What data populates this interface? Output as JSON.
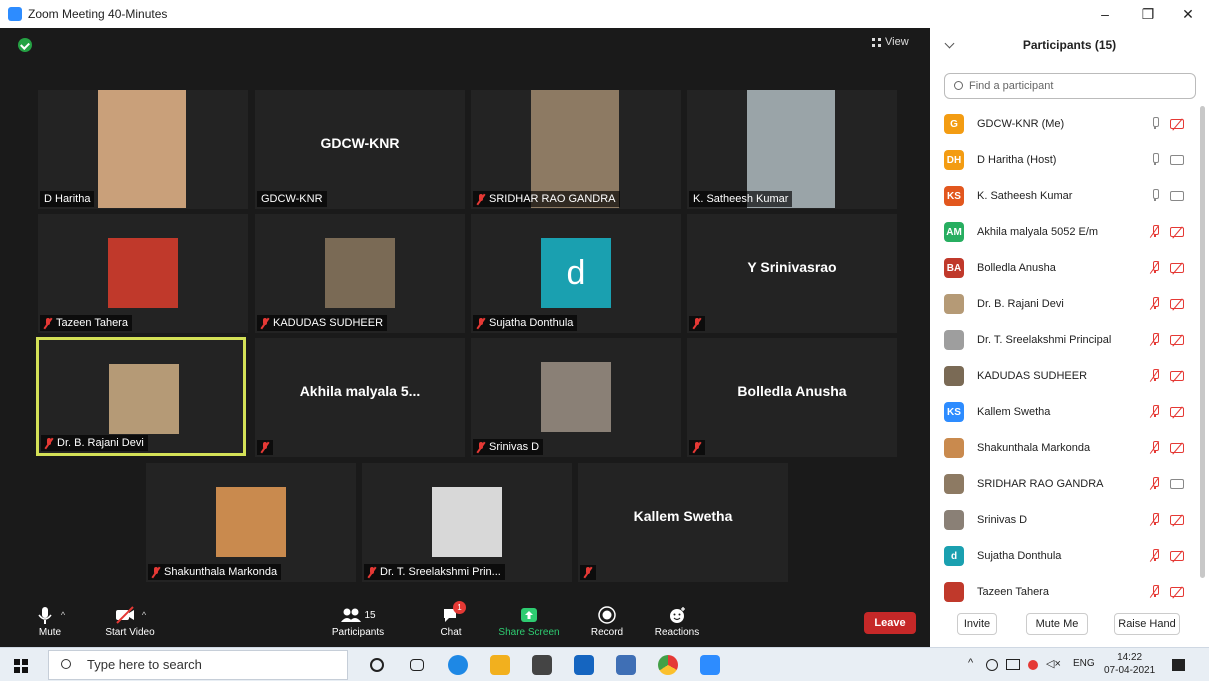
{
  "window": {
    "title": "Zoom Meeting 40-Minutes",
    "minimize": "–",
    "maximize": "❐",
    "close": "✕"
  },
  "view_button": "View",
  "tiles": [
    {
      "name": "D Haritha",
      "muted": false,
      "kind": "photo",
      "color": "#c9a07a"
    },
    {
      "name": "GDCW-KNR",
      "muted": false,
      "kind": "name",
      "center": "GDCW-KNR",
      "label": ""
    },
    {
      "name": "SRIDHAR RAO GANDRA",
      "muted": true,
      "kind": "photo",
      "color": "#8d7a63"
    },
    {
      "name": "K. Satheesh Kumar",
      "muted": false,
      "kind": "photo",
      "color": "#9aa4a8"
    },
    {
      "name": "Tazeen Tahera",
      "muted": true,
      "kind": "photo",
      "color": "#c0392b"
    },
    {
      "name": "KADUDAS SUDHEER",
      "muted": true,
      "kind": "photo",
      "color": "#7a6a55"
    },
    {
      "name": "Sujatha Donthula",
      "muted": true,
      "kind": "letter",
      "letter": "d",
      "color": "#1aa0b0"
    },
    {
      "name": "",
      "muted": true,
      "kind": "name",
      "center": "Y Srinivasrao"
    },
    {
      "name": "Dr. B. Rajani Devi",
      "muted": true,
      "kind": "photo",
      "color": "#b59a76",
      "active": true
    },
    {
      "name": "",
      "muted": true,
      "kind": "name",
      "center": "Akhila malyala 5..."
    },
    {
      "name": "Srinivas D",
      "muted": true,
      "kind": "photo",
      "color": "#8a8076"
    },
    {
      "name": "",
      "muted": true,
      "kind": "name",
      "center": "Bolledla Anusha"
    },
    {
      "name": "Shakunthala Markonda",
      "muted": true,
      "kind": "photo",
      "color": "#c98a4e"
    },
    {
      "name": "Dr. T. Sreelakshmi Prin...",
      "muted": true,
      "kind": "photo",
      "color": "#d8d8d8"
    },
    {
      "name": "",
      "muted": true,
      "kind": "name",
      "center": "Kallem Swetha"
    }
  ],
  "toolbar": {
    "mute": "Mute",
    "start_video": "Start Video",
    "participants": "Participants",
    "participants_count": "15",
    "chat": "Chat",
    "chat_badge": "1",
    "share_screen": "Share Screen",
    "record": "Record",
    "reactions": "Reactions",
    "leave": "Leave"
  },
  "panel": {
    "title": "Participants (15)",
    "search_placeholder": "Find a participant",
    "participants": [
      {
        "initials": "G",
        "name": "GDCW-KNR (Me)",
        "color": "#f39c12",
        "mic": "on",
        "video": "off"
      },
      {
        "initials": "DH",
        "name": "D Haritha (Host)",
        "color": "#f39c12",
        "mic": "on",
        "video": "on"
      },
      {
        "initials": "KS",
        "name": "K. Satheesh Kumar",
        "color": "#e2571e",
        "mic": "on",
        "video": "on"
      },
      {
        "initials": "AM",
        "name": "Akhila malyala 5052 E/m",
        "color": "#27ae60",
        "mic": "off",
        "video": "off"
      },
      {
        "initials": "BA",
        "name": "Bolledla Anusha",
        "color": "#c0392b",
        "mic": "off",
        "video": "off"
      },
      {
        "initials": "",
        "name": "Dr. B. Rajani Devi",
        "color": "#b59a76",
        "mic": "off",
        "video": "off"
      },
      {
        "initials": "",
        "name": "Dr. T. Sreelakshmi Principal",
        "color": "#9e9e9e",
        "mic": "off",
        "video": "off"
      },
      {
        "initials": "",
        "name": "KADUDAS SUDHEER",
        "color": "#7a6a55",
        "mic": "off",
        "video": "off"
      },
      {
        "initials": "KS",
        "name": "Kallem Swetha",
        "color": "#2d8cff",
        "mic": "off",
        "video": "off"
      },
      {
        "initials": "",
        "name": "Shakunthala Markonda",
        "color": "#c98a4e",
        "mic": "off",
        "video": "off"
      },
      {
        "initials": "",
        "name": "SRIDHAR RAO GANDRA",
        "color": "#8d7a63",
        "mic": "off",
        "video": "on"
      },
      {
        "initials": "",
        "name": "Srinivas D",
        "color": "#8a8076",
        "mic": "off",
        "video": "off"
      },
      {
        "initials": "d",
        "name": "Sujatha Donthula",
        "color": "#1aa0b0",
        "mic": "off",
        "video": "off"
      },
      {
        "initials": "",
        "name": "Tazeen Tahera",
        "color": "#c0392b",
        "mic": "off",
        "video": "off"
      }
    ],
    "invite": "Invite",
    "mute_me": "Mute Me",
    "raise_hand": "Raise Hand"
  },
  "taskbar": {
    "search_placeholder": "Type here to search",
    "lang": "ENG",
    "time": "14:22",
    "date": "07-04-2021"
  }
}
